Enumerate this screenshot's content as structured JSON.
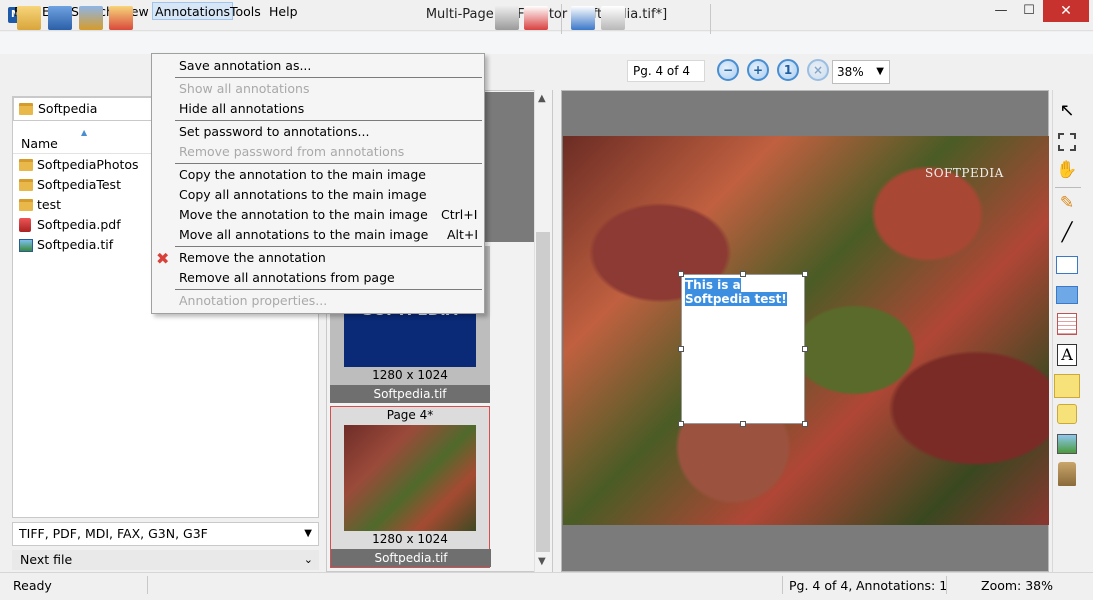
{
  "window": {
    "title": "Multi-Page TIFF Editor [Softpedia.tif*]",
    "app_icon": "tiff-app-icon",
    "min": "—",
    "max": "☐",
    "close": "✕"
  },
  "menubar": {
    "items": [
      "File",
      "Edit",
      "Search",
      "View",
      "Annotations",
      "Tools",
      "Help"
    ]
  },
  "toolbar": {
    "page_indicator": "Pg. 4 of 4",
    "zoom": "38%"
  },
  "left": {
    "current_folder": "Softpedia",
    "column_name": "Name",
    "files": [
      {
        "name": "SoftpediaPhotos",
        "icon": "folder-icon"
      },
      {
        "name": "SoftpediaTest",
        "icon": "folder-icon"
      },
      {
        "name": "test",
        "icon": "folder-icon"
      },
      {
        "name": "Softpedia.pdf",
        "icon": "pdf-icon"
      },
      {
        "name": "Softpedia.tif",
        "icon": "image-icon"
      }
    ],
    "filter": "TIFF, PDF, MDI, FAX, G3N, G3F",
    "next_file": "Next file"
  },
  "thumbnails": [
    {
      "image_text": "SOFTPEDIA",
      "dimensions": "1280 x 1024",
      "name": "Softpedia.tif"
    },
    {
      "label": "Page 4*",
      "dimensions": "1280 x 1024",
      "name": "Softpedia.tif"
    }
  ],
  "viewer": {
    "watermark": "SOFTPEDIA",
    "annotation_text": "This is a Softpedia test!"
  },
  "annotations_menu": {
    "items": [
      {
        "label": "Save annotation as...",
        "enabled": true
      },
      {
        "label": "Show all annotations",
        "enabled": false
      },
      {
        "label": "Hide all annotations",
        "enabled": true
      },
      {
        "label": "Set password to annotations...",
        "enabled": true
      },
      {
        "label": "Remove password from annotations",
        "enabled": false
      },
      {
        "label": "Copy the annotation to the main image",
        "enabled": true
      },
      {
        "label": "Copy all annotations to the main image",
        "enabled": true
      },
      {
        "label": "Move the annotation to the main image",
        "enabled": true,
        "shortcut": "Ctrl+I"
      },
      {
        "label": "Move all annotations to the main image",
        "enabled": true,
        "shortcut": "Alt+I"
      },
      {
        "label": "Remove the annotation",
        "enabled": true,
        "icon": "red-x-icon"
      },
      {
        "label": "Remove all annotations from page",
        "enabled": true
      },
      {
        "label": "Annotation properties...",
        "enabled": false
      }
    ]
  },
  "status": {
    "ready": "Ready",
    "page": "Pg. 4 of 4,",
    "annotations": "Annotations: 1",
    "zoom": "Zoom: 38%"
  },
  "colors": {
    "accent": "#3c8fe0",
    "close_button": "#c7322e",
    "selected_thumb_border": "#d45050"
  }
}
